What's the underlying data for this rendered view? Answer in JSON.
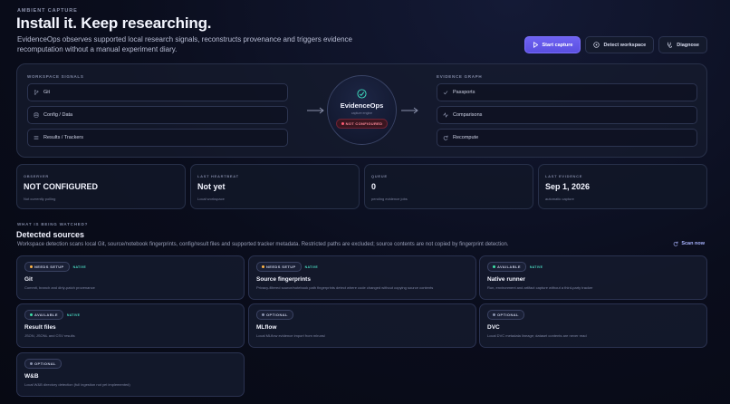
{
  "header": {
    "eyebrow": "AMBIENT CAPTURE",
    "title": "Install it. Keep researching.",
    "lede": "EvidenceOps observes supported local research signals, reconstructs provenance and triggers evidence recomputation without a manual experiment diary."
  },
  "actions": {
    "start_capture": "Start capture",
    "detect_workspace": "Detect workspace",
    "diagnose": "Diagnose"
  },
  "pipeline": {
    "signals_label": "WORKSPACE SIGNALS",
    "signals": [
      {
        "label": "Git",
        "icon": "git-branch-icon"
      },
      {
        "label": "Config / Data",
        "icon": "database-icon"
      },
      {
        "label": "Results / Trackers",
        "icon": "list-icon"
      }
    ],
    "hub": {
      "name": "EvidenceOps",
      "sub": "capture engine",
      "status": "NOT CONFIGURED"
    },
    "graph_label": "EVIDENCE GRAPH",
    "outputs": [
      {
        "label": "Passports",
        "icon": "check-icon"
      },
      {
        "label": "Comparisons",
        "icon": "activity-icon"
      },
      {
        "label": "Recompute",
        "icon": "refresh-icon"
      }
    ]
  },
  "stats": [
    {
      "label": "OBSERVER",
      "value": "NOT CONFIGURED",
      "sub": "Not currently polling"
    },
    {
      "label": "LAST HEARTBEAT",
      "value": "Not yet",
      "sub": "Local workspace"
    },
    {
      "label": "QUEUE",
      "value": "0",
      "sub": "pending evidence jobs"
    },
    {
      "label": "LAST EVIDENCE",
      "value": "Sep 1, 2026",
      "sub": "automatic capture"
    }
  ],
  "sources": {
    "eyebrow": "WHAT IS BEING WATCHED?",
    "title": "Detected sources",
    "description": "Workspace detection scans local Git, source/notebook fingerprints, config/result files and supported tracker metadata. Restricted paths are excluded; source contents are not copied by fingerprint detection.",
    "scan_label": "Scan now",
    "cards": [
      {
        "status": "NEEDS SETUP",
        "native": "NATIVE",
        "title": "Git",
        "desc": "Commit, branch and dirty-patch provenance"
      },
      {
        "status": "NEEDS SETUP",
        "native": "NATIVE",
        "title": "Source fingerprints",
        "desc": "Privacy-filtered source/notebook path fingerprints detect where code changed without copying source contents"
      },
      {
        "status": "AVAILABLE",
        "native": "NATIVE",
        "title": "Native runner",
        "desc": "Run, environment and artifact capture without a third-party tracker"
      },
      {
        "status": "AVAILABLE",
        "native": "NATIVE",
        "title": "Result files",
        "desc": "JSON, JSONL and CSV results"
      },
      {
        "status": "OPTIONAL",
        "native": "",
        "title": "MLflow",
        "desc": "Local MLflow evidence import from mlruns/"
      },
      {
        "status": "OPTIONAL",
        "native": "",
        "title": "DVC",
        "desc": "Local DVC metadata lineage; dataset contents are never read"
      },
      {
        "status": "OPTIONAL",
        "native": "",
        "title": "W&B",
        "desc": "Local W&B directory detection (full ingestion not yet implemented)"
      }
    ]
  },
  "colors": {
    "accent": "#6f63f2",
    "needs_setup": "#ffb547",
    "available": "#3ee0a8",
    "optional": "#8a92ad",
    "danger": "#ff5a73",
    "native": "#4ad8c0"
  }
}
